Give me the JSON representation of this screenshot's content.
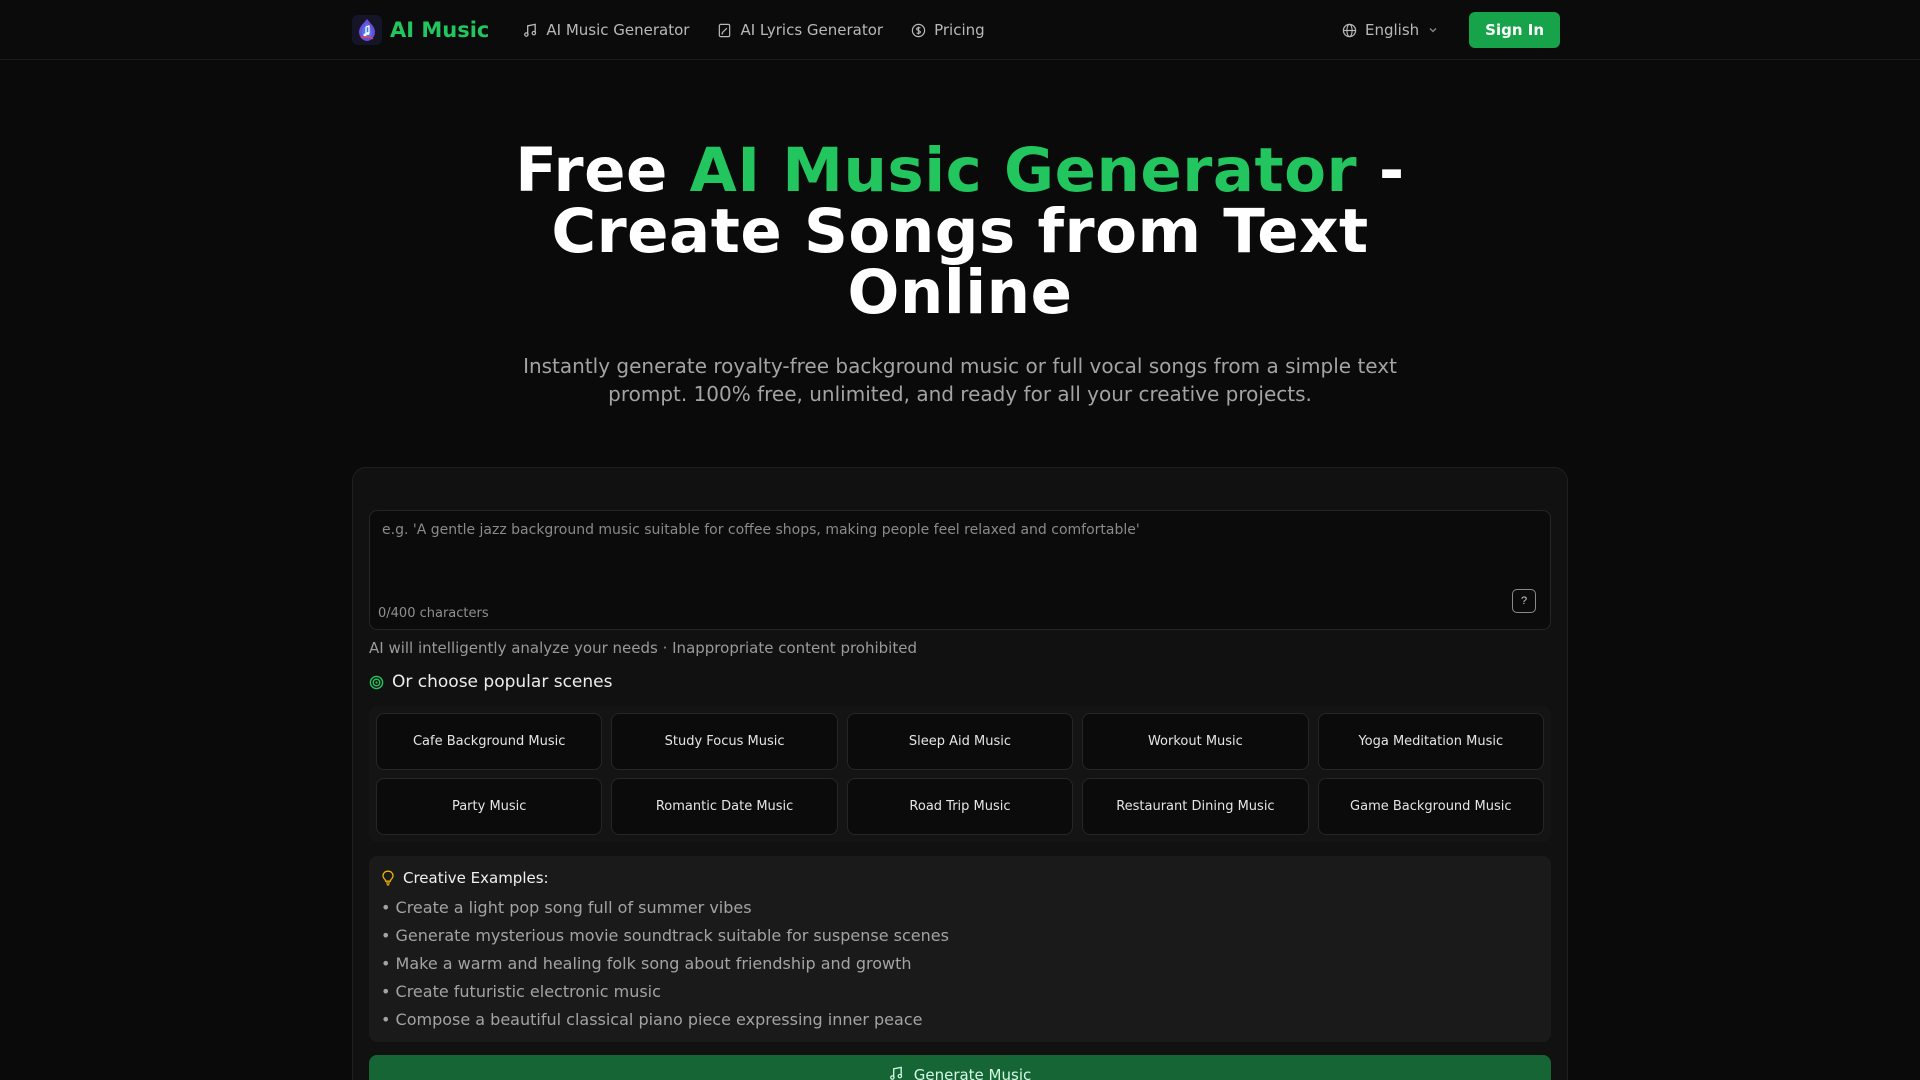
{
  "header": {
    "logo_text": "AI Music",
    "nav": [
      {
        "label": "AI Music Generator",
        "icon": "music-note-icon"
      },
      {
        "label": "AI Lyrics Generator",
        "icon": "document-edit-icon"
      },
      {
        "label": "Pricing",
        "icon": "dollar-circle-icon"
      }
    ],
    "language": "English",
    "signin_label": "Sign In"
  },
  "hero": {
    "title_part1": "Free ",
    "title_highlight": "AI Music Generator",
    "title_part2": " - Create Songs from Text Online",
    "subtitle": "Instantly generate royalty-free background music or full vocal songs from a simple text prompt. 100% free, unlimited, and ready for all your creative projects."
  },
  "generator": {
    "prompt_placeholder": "e.g. 'A gentle jazz background music suitable for coffee shops, making people feel relaxed and comfortable'",
    "prompt_value": "",
    "char_count": "0/400 characters",
    "help_label": "?",
    "hint": "AI will intelligently analyze your needs · Inappropriate content prohibited",
    "scenes_title": "Or choose popular scenes",
    "scenes": [
      "Cafe Background Music",
      "Study Focus Music",
      "Sleep Aid Music",
      "Workout Music",
      "Yoga Meditation Music",
      "Party Music",
      "Romantic Date Music",
      "Road Trip Music",
      "Restaurant Dining Music",
      "Game Background Music"
    ],
    "examples_title": "Creative Examples:",
    "examples": [
      "• Create a light pop song full of summer vibes",
      "• Generate mysterious movie soundtrack suitable for suspense scenes",
      "• Make a warm and healing folk song about friendship and growth",
      "• Create futuristic electronic music",
      "• Compose a beautiful classical piano piece expressing inner peace"
    ],
    "generate_label": "Generate Music"
  },
  "colors": {
    "accent": "#22c55e",
    "button": "#16a34a",
    "background": "#0a0a0a"
  }
}
